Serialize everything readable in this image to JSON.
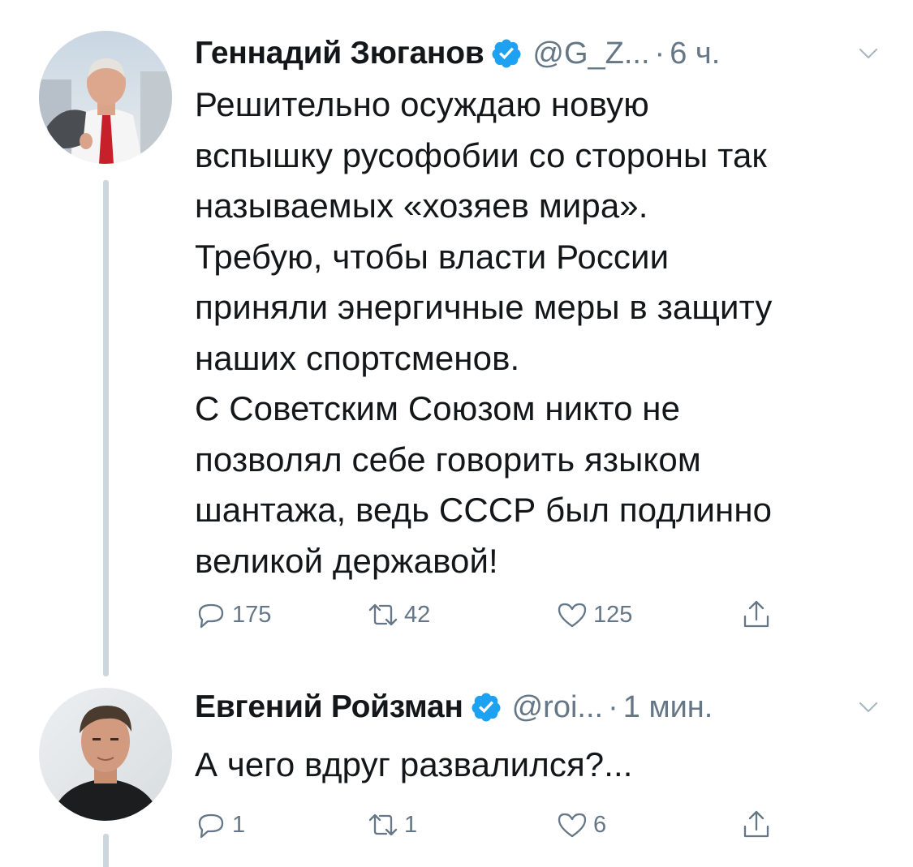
{
  "colors": {
    "text": "#14171a",
    "secondary": "#657786",
    "verified": "#1da1f2",
    "thread_line": "#ccd6dd",
    "background": "#ffffff"
  },
  "tweets": [
    {
      "name": "Геннадий Зюганов",
      "verified": true,
      "handle": "@G_Z...",
      "separator": "·",
      "time": "6 ч.",
      "text": "Решительно осуждаю новую\nвспышку русофобии со стороны так\nназываемых «хозяев мира».\nТребую, чтобы власти России\nприняли энергичные меры в защиту\nнаших спортсменов.\nС Советским Союзом никто не\nпозволял себе говорить языком\nшантажа, ведь СССР был подлинно\nвеликой державой!",
      "replies": "175",
      "retweets": "42",
      "likes": "125",
      "avatar_icon": "user-avatar-photo"
    },
    {
      "name": "Евгений Ройзман",
      "verified": true,
      "handle": "@roi...",
      "separator": "·",
      "time": "1 мин.",
      "text": "А чего вдруг развалился?...",
      "replies": "1",
      "retweets": "1",
      "likes": "6",
      "avatar_icon": "user-avatar-photo"
    }
  ],
  "icons": {
    "reply": "reply-icon",
    "retweet": "retweet-icon",
    "like": "heart-icon",
    "share": "share-icon",
    "verified": "verified-badge-icon",
    "menu": "chevron-down-icon"
  }
}
